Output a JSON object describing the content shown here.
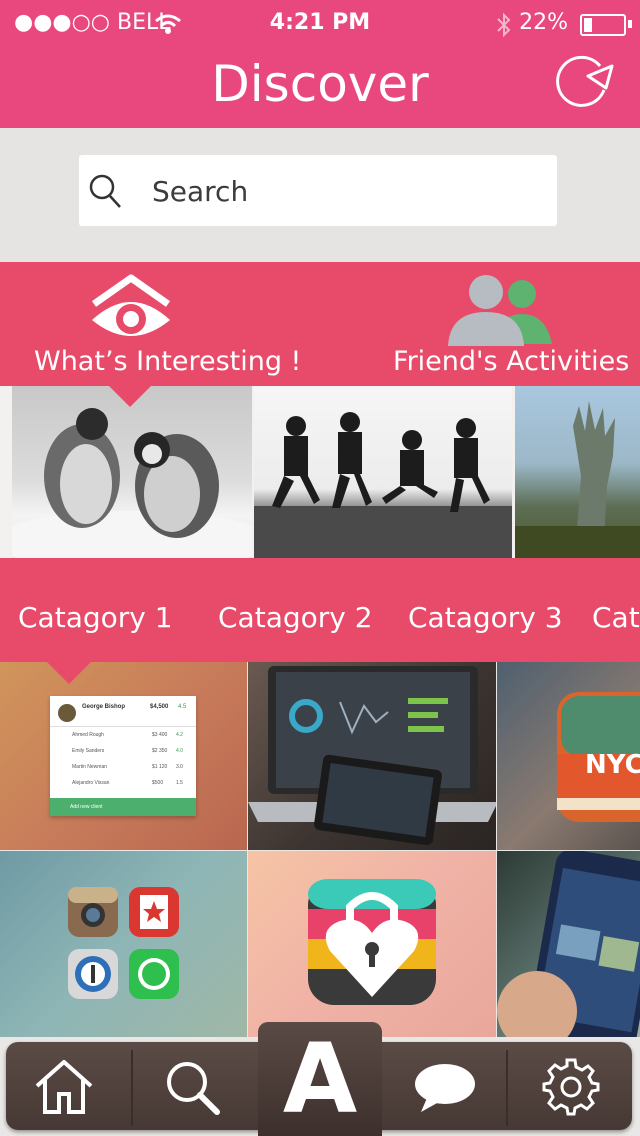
{
  "status_bar": {
    "carrier": "●●●○○ BELL",
    "time": "4:21 PM",
    "battery": "22%",
    "battery_level": 0.22
  },
  "header": {
    "title": "Discover",
    "refresh_icon": "refresh-icon"
  },
  "search": {
    "placeholder": "Search",
    "icon": "search-icon"
  },
  "feed_tabs": [
    {
      "label": "What’s Interesting !",
      "icon": "eye-icon",
      "selected": true
    },
    {
      "label": "Friend's Activities",
      "icon": "friends-icon",
      "selected": false
    }
  ],
  "categories": [
    {
      "label": "Catagory 1",
      "selected": true
    },
    {
      "label": "Catagory 2",
      "selected": false
    },
    {
      "label": "Catagory 3",
      "selected": false
    },
    {
      "label": "Cata",
      "selected": false
    }
  ],
  "tile1_card": {
    "name": "George Bishop",
    "total": "$4,500",
    "rating": "4.5",
    "rows": [
      {
        "name": "Ahmed Rough",
        "value": "$3 400",
        "rate": "4.2"
      },
      {
        "name": "Emily Sanders",
        "value": "$2 350",
        "rate": "4.0"
      },
      {
        "name": "Martin Newman",
        "value": "$1 120",
        "rate": "3.0"
      },
      {
        "name": "Alejandro Vissan",
        "value": "$500",
        "rate": "1.5"
      }
    ],
    "footer": "Add new client"
  },
  "tile3_text": "NYC",
  "tab_bar": {
    "center_label": "A",
    "items": [
      "home-icon",
      "search-icon",
      "a-logo",
      "chat-icon",
      "gear-icon"
    ]
  },
  "colors": {
    "header": "#e9487f",
    "band": "#e84a6a",
    "tabbar": "#4f403b"
  }
}
